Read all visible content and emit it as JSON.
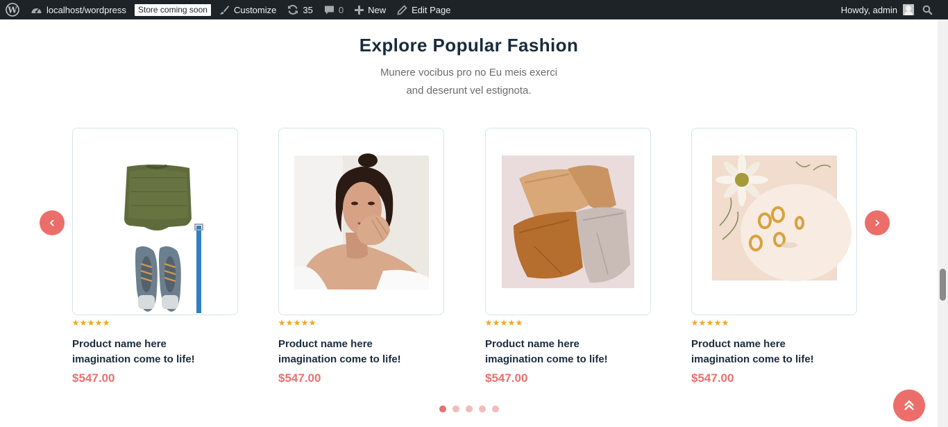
{
  "admin_bar": {
    "site_name": "localhost/wordpress",
    "store_badge": "Store coming soon",
    "customize": "Customize",
    "updates_count": "35",
    "comments_count": "0",
    "new_label": "New",
    "edit_page": "Edit Page",
    "greeting": "Howdy, admin",
    "icons": [
      "wordpress-logo-icon",
      "dashboard-icon",
      "brush-icon",
      "refresh-icon",
      "comment-icon",
      "plus-icon",
      "pencil-icon",
      "search-icon"
    ]
  },
  "section": {
    "title": "Explore Popular Fashion",
    "subtitle_line1": "Munere vocibus pro no Eu meis exerci",
    "subtitle_line2": "and deserunt vel estignota."
  },
  "products": [
    {
      "name_line1": "Product name here",
      "name_line2": "imagination come to life!",
      "price": "$547.00",
      "rating": 5,
      "image": "sweater-shoes-belt"
    },
    {
      "name_line1": "Product name here",
      "name_line2": "imagination come to life!",
      "price": "$547.00",
      "rating": 5,
      "image": "woman-portrait"
    },
    {
      "name_line1": "Product name here",
      "name_line2": "imagination come to life!",
      "price": "$547.00",
      "rating": 5,
      "image": "folded-pants"
    },
    {
      "name_line1": "Product name here",
      "name_line2": "imagination come to life!",
      "price": "$547.00",
      "rating": 5,
      "image": "gold-rings-flower"
    }
  ],
  "carousel": {
    "slide_count": 5,
    "active_index": 0
  },
  "colors": {
    "accent": "#ec6e6a",
    "price": "#e8716f",
    "heading": "#1a2b3c",
    "admin_bar": "#1d2327",
    "star": "#f5a623"
  }
}
